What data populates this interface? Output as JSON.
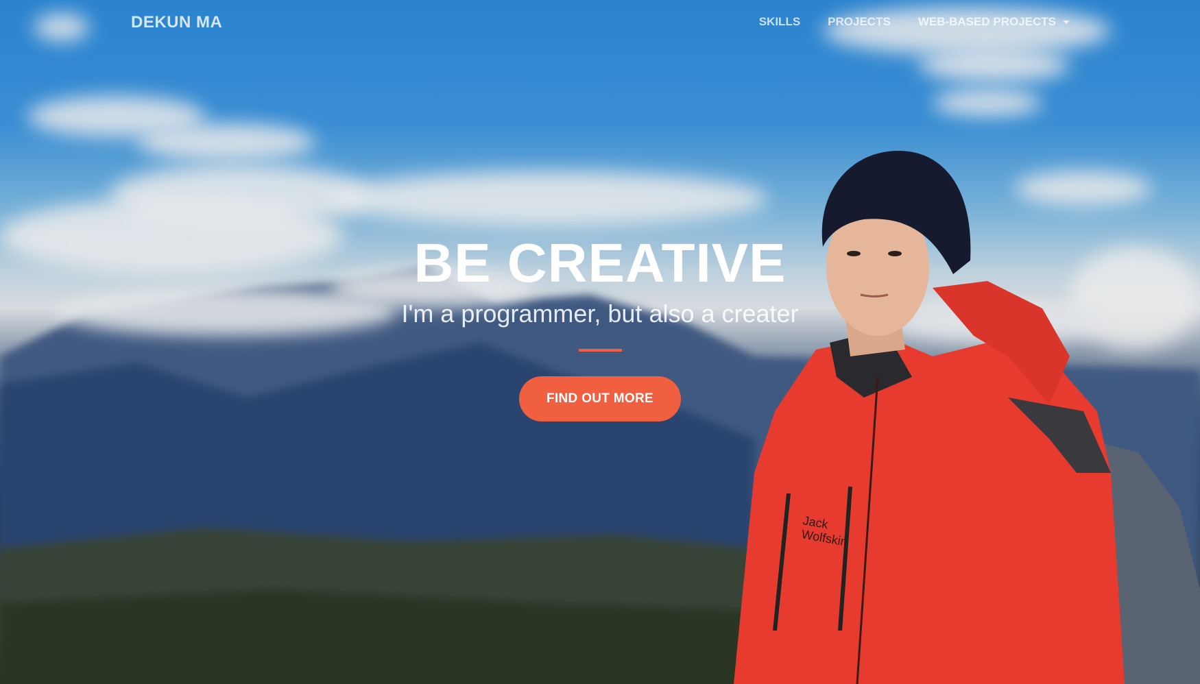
{
  "navbar": {
    "brand": "DEKUN MA",
    "links": [
      {
        "label": "SKILLS"
      },
      {
        "label": "PROJECTS"
      },
      {
        "label": "WEB-BASED PROJECTS",
        "has_dropdown": true
      }
    ]
  },
  "hero": {
    "title": "BE CREATIVE",
    "subtitle": "I'm a programmer, but also a creater",
    "cta_label": "FIND OUT MORE"
  },
  "colors": {
    "accent": "#f05f40",
    "text": "#ffffff"
  },
  "icons": {
    "dropdown": "caret-down-icon"
  }
}
